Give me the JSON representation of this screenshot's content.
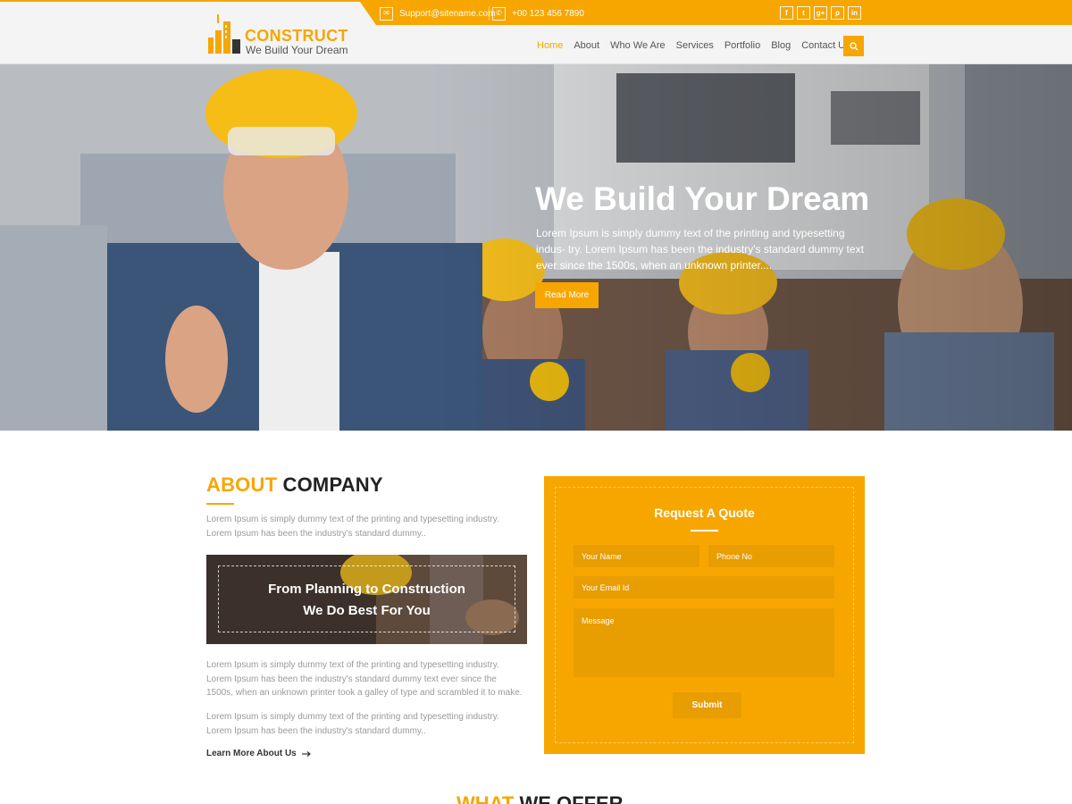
{
  "header": {
    "brand": "CONSTRUCT",
    "tagline": "We Build Your Dream",
    "email": "Support@sitename.com",
    "phone": "+00 123 456 7890",
    "social": [
      "f",
      "t",
      "g+",
      "p",
      "in"
    ],
    "nav": [
      "Home",
      "About",
      "Who We Are",
      "Services",
      "Portfolio",
      "Blog",
      "Contact Us"
    ],
    "active_nav": "Home"
  },
  "hero": {
    "title": "We Build Your Dream",
    "text": "Lorem Ipsum is simply dummy text of the printing and typesetting indus- try. Lorem Ipsum has been the industry's standard dummy text ever since the 1500s, when an unknown printer....",
    "button": "Read More"
  },
  "about": {
    "title_highlight": "ABOUT",
    "title_rest": " COMPANY",
    "text1": "Lorem Ipsum is simply dummy text of the printing and typesetting industry. Lorem Ipsum has been the industry's standard dummy..",
    "promo_line1": "From Planning to Construction",
    "promo_line2": "We Do Best For You",
    "text2": "Lorem Ipsum is simply dummy text of the printing and typesetting industry. Lorem Ipsum has been the industry's standard dummy text ever since the 1500s, when an unknown printer took a galley of type and scrambled it to make.",
    "text3": "Lorem Ipsum is simply dummy text of the printing and typesetting industry. Lorem Ipsum has been the industry's standard dummy..",
    "learn_more": "Learn More About Us"
  },
  "quote": {
    "title": "Request A Quote",
    "name_placeholder": "Your Name",
    "phone_placeholder": "Phone No",
    "email_placeholder": "Your Email Id",
    "message_placeholder": "Message",
    "submit": "Submit"
  },
  "offer": {
    "title_highlight": "WHAT",
    "title_rest": " WE OFFER"
  },
  "colors": {
    "accent": "#f7a600",
    "accent_dark": "#e89d00"
  }
}
